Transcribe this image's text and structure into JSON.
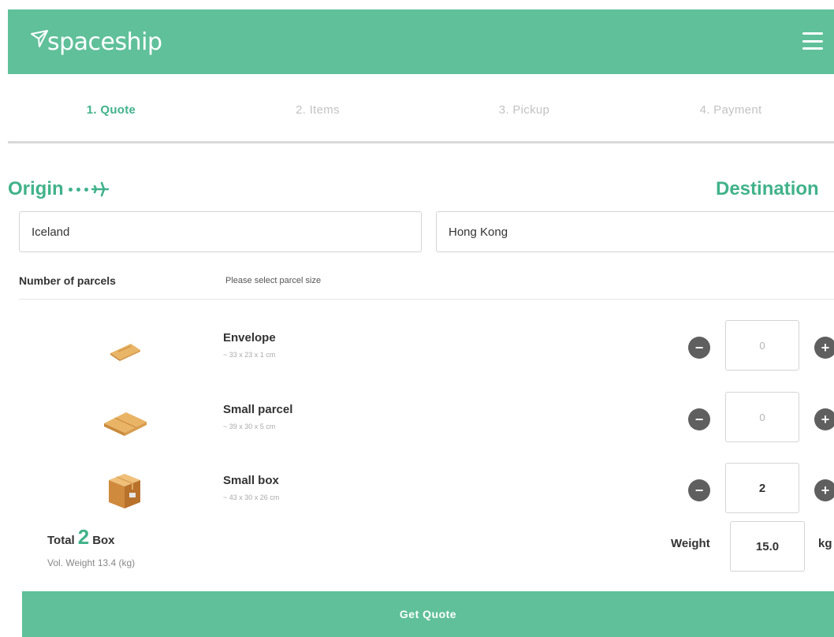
{
  "header": {
    "logo_text": "spaceship"
  },
  "steps": [
    {
      "label": "1. Quote",
      "active": true
    },
    {
      "label": "2. Items",
      "active": false
    },
    {
      "label": "3. Pickup",
      "active": false
    },
    {
      "label": "4. Payment",
      "active": false
    }
  ],
  "route": {
    "origin_title": "Origin",
    "destination_title": "Destination",
    "origin_value": "Iceland",
    "destination_value": "Hong Kong"
  },
  "parcels": {
    "label": "Number of parcels",
    "hint": "Please select parcel size",
    "items": [
      {
        "name": "Envelope",
        "dims": "~ 33 x 23 x 1 cm",
        "qty": "0"
      },
      {
        "name": "Small parcel",
        "dims": "~ 39 x 30 x 5 cm",
        "qty": "0"
      },
      {
        "name": "Small box",
        "dims": "~ 43 x 30 x 26 cm",
        "qty": "2"
      }
    ],
    "minus_symbol": "−",
    "plus_symbol": "+"
  },
  "summary": {
    "total_label": "Total",
    "total_count": "2",
    "total_unit": "Box",
    "vol_weight": "Vol. Weight 13.4 (kg)",
    "weight_label": "Weight",
    "weight_value": "15.0",
    "weight_unit": "kg"
  },
  "actions": {
    "get_quote_label": "Get Quote"
  },
  "colors": {
    "brand": "#5fc09a",
    "accent_text": "#41b28a",
    "stepper": "#5f5f5f"
  },
  "icons": {
    "logo": "paper-plane-icon",
    "menu": "hamburger-menu-icon",
    "route": "airplane-icon",
    "envelope": "envelope-icon",
    "small_parcel": "small-parcel-icon",
    "small_box": "small-box-icon"
  }
}
